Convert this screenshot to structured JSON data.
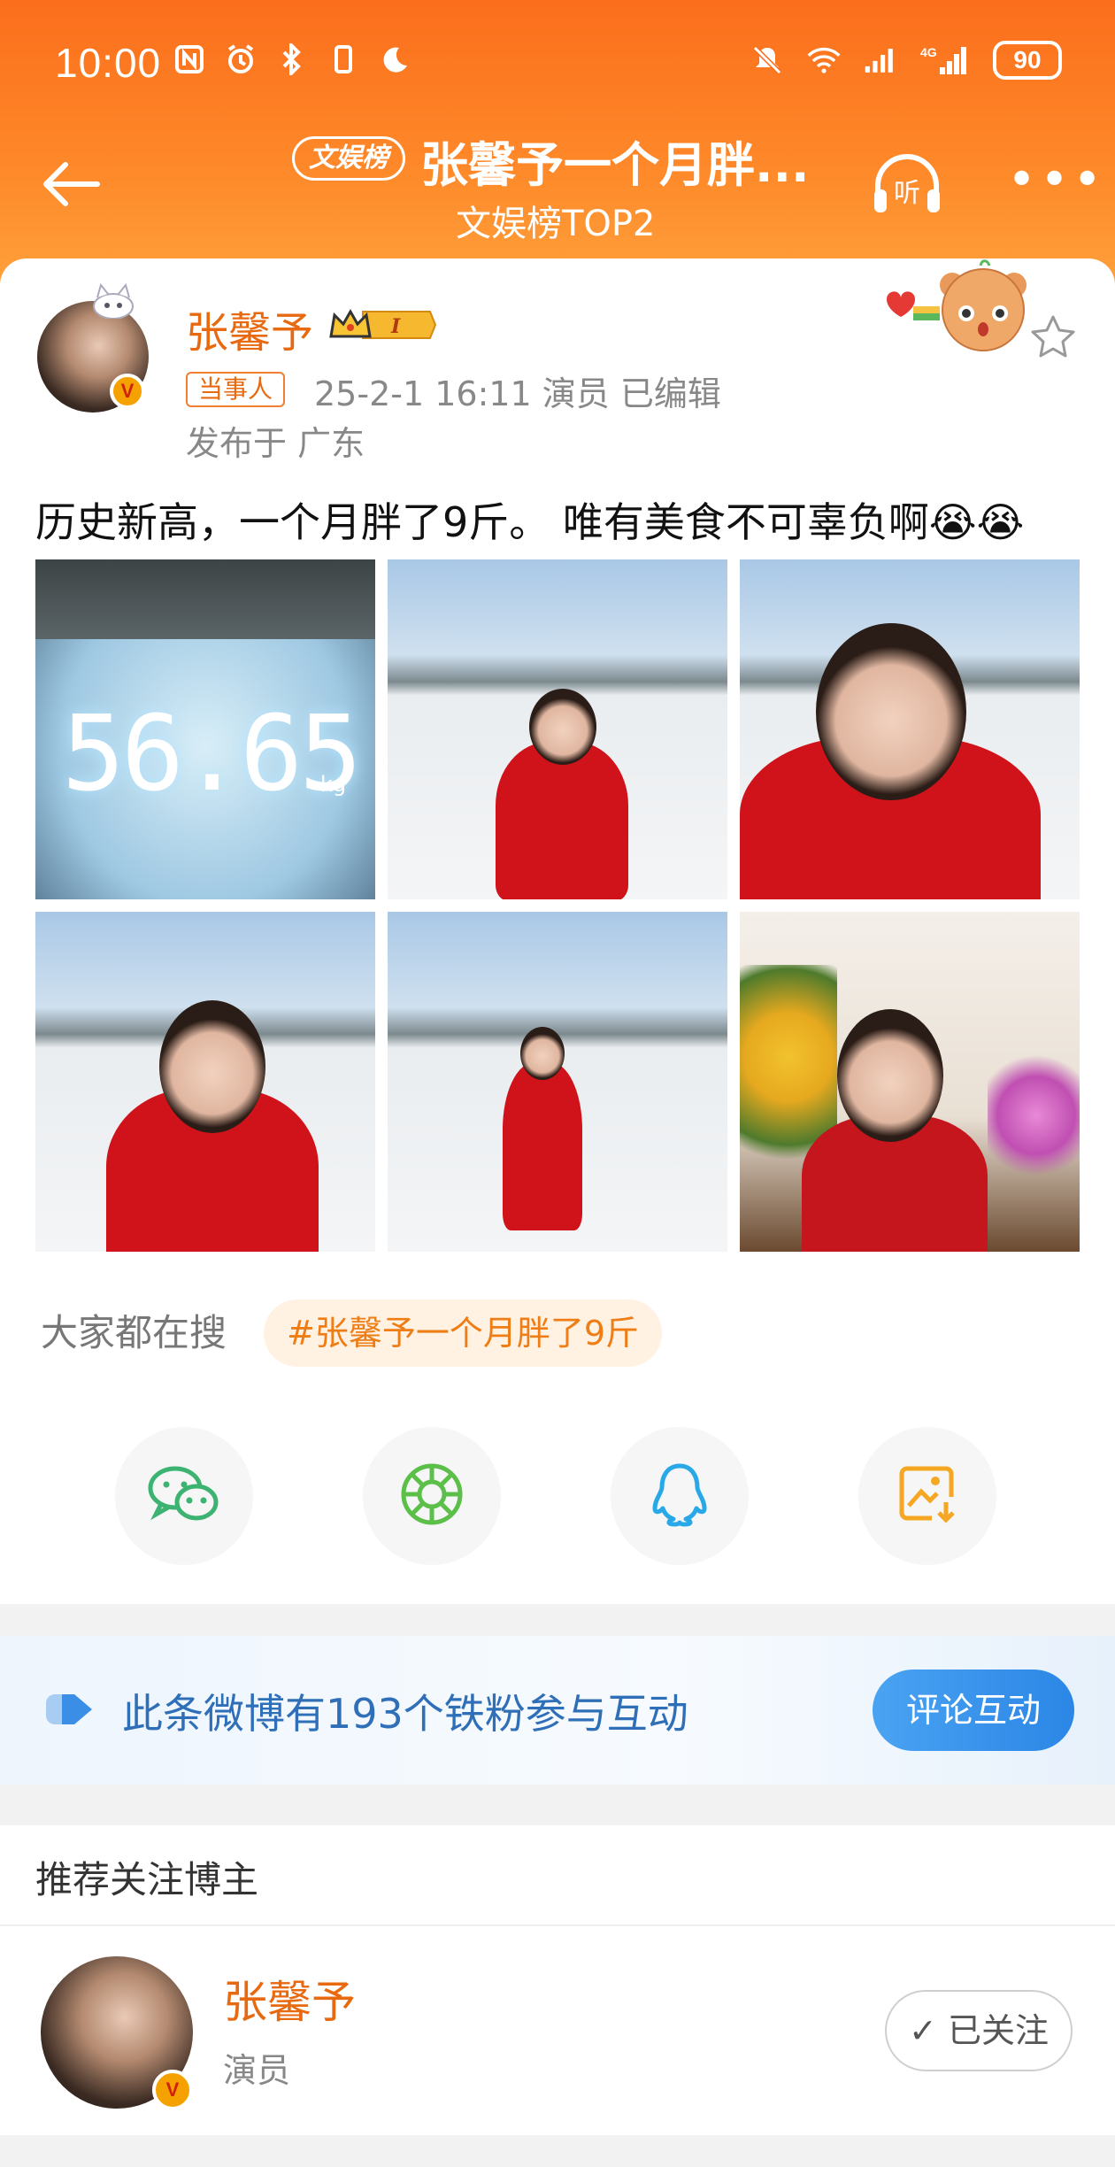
{
  "status_bar": {
    "time": "10:00",
    "battery": "90",
    "network": "4G"
  },
  "nav": {
    "tag": "文娱榜",
    "title": "张馨予一个月胖...",
    "subtitle": "文娱榜TOP2",
    "listen_label": "听"
  },
  "post": {
    "author": "张馨予",
    "level_badge": "I",
    "role_tag": "当事人",
    "meta": "25-2-1 16:11   演员   已编辑",
    "location": "发布于 广东",
    "text": "历史新高，一个月胖了9斤。 唯有美食不可辜负啊😭😭",
    "scale_reading": "56.65",
    "scale_unit": "kg"
  },
  "hot_search": {
    "label": "大家都在搜",
    "topic": "#张馨予一个月胖了9斤"
  },
  "share": [
    {
      "name": "wechat-icon",
      "color": "#3cb371"
    },
    {
      "name": "moments-icon",
      "color": "#5cbf4a"
    },
    {
      "name": "qq-icon",
      "color": "#29a8e8"
    },
    {
      "name": "save-image-icon",
      "color": "#f5a623"
    }
  ],
  "fans_banner": {
    "text": "此条微博有193个铁粉参与互动",
    "button": "评论互动"
  },
  "recommend": {
    "title": "推荐关注博主",
    "name": "张馨予",
    "role": "演员",
    "follow_label": "✓ 已关注"
  },
  "colors": {
    "header": "#fb6e1c",
    "accent": "#e86a10",
    "link_blue": "#2f6fb8"
  }
}
